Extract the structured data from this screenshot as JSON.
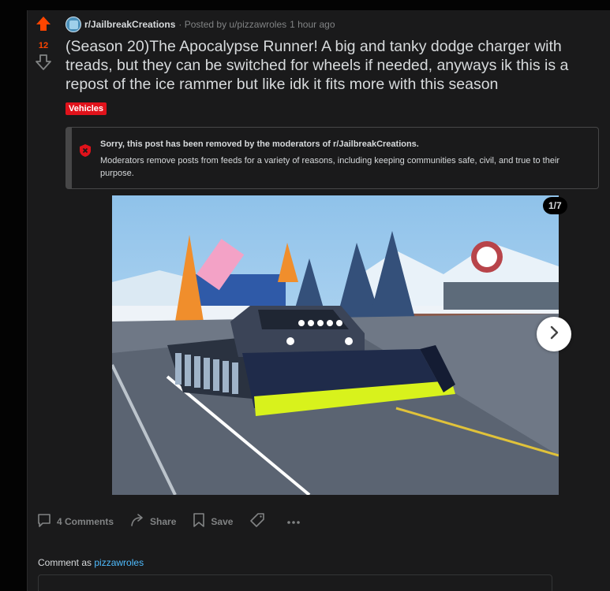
{
  "post": {
    "subreddit": "r/JailbreakCreations",
    "posted_by": "· Posted by u/pizzawroles",
    "time": "1 hour ago",
    "vote_count": "12",
    "title": "(Season 20)The Apocalypse Runner! A big and tanky dodge charger with treads, but they can be switched for wheels if needed, anyways ik this is a repost of the ice rammer but like idk it fits more with this season",
    "flair": "Vehicles"
  },
  "removed_notice": {
    "heading": "Sorry, this post has been removed by the moderators of r/JailbreakCreations.",
    "body": "Moderators remove posts from feeds for a variety of reasons, including keeping communities safe, civil, and true to their purpose."
  },
  "gallery": {
    "counter": "1/7"
  },
  "actions": {
    "comments": "4 Comments",
    "share": "Share",
    "save": "Save"
  },
  "comment": {
    "label": "Comment as",
    "user": "pizzawroles"
  },
  "colors": {
    "upvote": "#ff4500",
    "flair": "#e0121b",
    "link": "#4fbcff"
  }
}
